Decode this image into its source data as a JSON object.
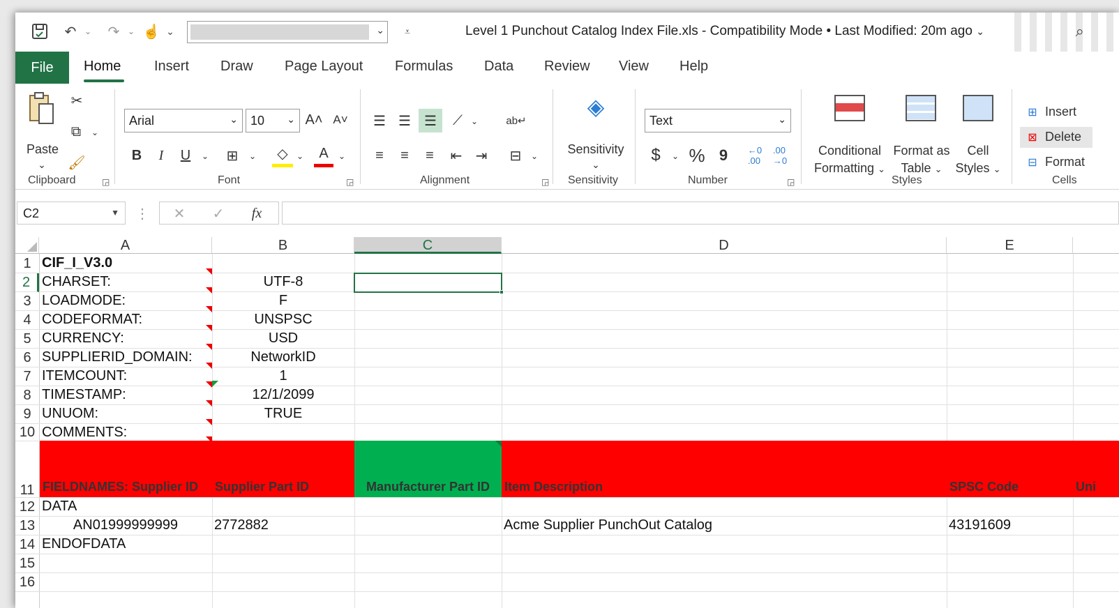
{
  "title": {
    "document": "Level 1 Punchout Catalog Index File.xls  -  Compatibility Mode • Last Modified: 20m ago"
  },
  "tabs": [
    "File",
    "Home",
    "Insert",
    "Draw",
    "Page Layout",
    "Formulas",
    "Data",
    "Review",
    "View",
    "Help"
  ],
  "ribbon": {
    "clipboard": {
      "paste": "Paste",
      "label": "Clipboard"
    },
    "font": {
      "name": "Arial",
      "size": "10",
      "label": "Font",
      "bold": "B",
      "italic": "I",
      "underline": "U"
    },
    "alignment": {
      "label": "Alignment"
    },
    "sensitivity": {
      "button": "Sensitivity",
      "label": "Sensitivity"
    },
    "number": {
      "format": "Text",
      "label": "Number",
      "dollar": "$",
      "percent": "%",
      "comma": "9"
    },
    "styles": {
      "conditional": [
        "Conditional",
        "Formatting"
      ],
      "format_table": [
        "Format as",
        "Table"
      ],
      "cell_styles": [
        "Cell",
        "Styles"
      ],
      "label": "Styles"
    },
    "cells": {
      "insert": "Insert",
      "delete": "Delete",
      "format": "Format",
      "label": "Cells"
    }
  },
  "formula_bar": {
    "name_box": "C2",
    "fx": "fx",
    "formula": ""
  },
  "columns": [
    "A",
    "B",
    "C",
    "D",
    "E"
  ],
  "rows": [
    "1",
    "2",
    "3",
    "4",
    "5",
    "6",
    "7",
    "8",
    "9",
    "10",
    "11",
    "12",
    "13",
    "14",
    "15",
    "16"
  ],
  "cells": {
    "a1": "CIF_I_V3.0",
    "a2": "CHARSET:",
    "b2": "UTF-8",
    "a3": "LOADMODE:",
    "b3": "F",
    "a4": "CODEFORMAT:",
    "b4": "UNSPSC",
    "a5": "CURRENCY:",
    "b5": "USD",
    "a6": "SUPPLIERID_DOMAIN:",
    "b6": "NetworkID",
    "a7": "ITEMCOUNT:",
    "b7": "1",
    "a8": "TIMESTAMP:",
    "b8": "12/1/2099",
    "a9": "UNUOM:",
    "b9": "TRUE",
    "a10": "COMMENTS:",
    "a11": "FIELDNAMES: Supplier ID",
    "b11": "Supplier Part ID",
    "c11": "Manufacturer Part ID",
    "d11": "Item Description",
    "e11": "SPSC Code",
    "f11": "Uni",
    "a12": "DATA",
    "a13": "AN01999999999",
    "b13": "2772882",
    "d13": "Acme Supplier PunchOut Catalog",
    "e13": "43191609",
    "a14": "ENDOFDATA"
  },
  "colors": {
    "excel_green": "#217346",
    "header_red": "#ff0000",
    "header_green": "#00b050"
  }
}
